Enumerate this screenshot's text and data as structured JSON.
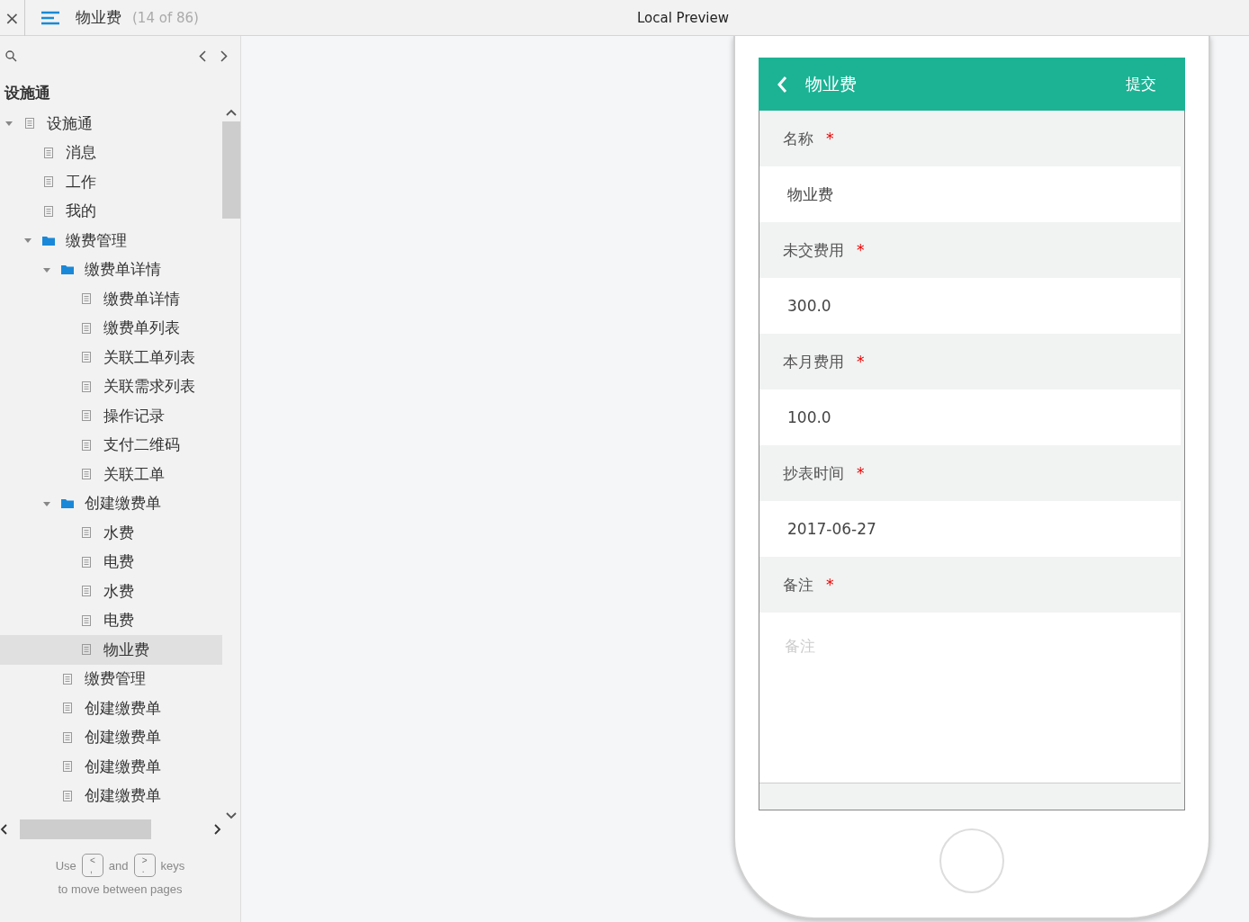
{
  "topbar": {
    "close": "×",
    "page_title": "物业费",
    "page_count": "(14 of 86)",
    "center_title": "Local Preview"
  },
  "sidebar": {
    "heading": "设施通",
    "tree": [
      {
        "label": "设施通",
        "kind": "page",
        "expanded": true,
        "selected": false,
        "children": [
          {
            "label": "消息",
            "kind": "page",
            "selected": false
          },
          {
            "label": "工作",
            "kind": "page",
            "selected": false
          },
          {
            "label": "我的",
            "kind": "page",
            "selected": false
          },
          {
            "label": "缴费管理",
            "kind": "folder",
            "expanded": true,
            "selected": false,
            "children": [
              {
                "label": "缴费单详情",
                "kind": "folder",
                "expanded": true,
                "selected": false,
                "children": [
                  {
                    "label": "缴费单详情",
                    "kind": "page",
                    "selected": false
                  },
                  {
                    "label": "缴费单列表",
                    "kind": "page",
                    "selected": false
                  },
                  {
                    "label": "关联工单列表",
                    "kind": "page",
                    "selected": false
                  },
                  {
                    "label": "关联需求列表",
                    "kind": "page",
                    "selected": false
                  },
                  {
                    "label": "操作记录",
                    "kind": "page",
                    "selected": false
                  },
                  {
                    "label": "支付二维码",
                    "kind": "page",
                    "selected": false
                  },
                  {
                    "label": "关联工单",
                    "kind": "page",
                    "selected": false
                  }
                ]
              },
              {
                "label": "创建缴费单",
                "kind": "folder",
                "expanded": true,
                "selected": false,
                "children": [
                  {
                    "label": "水费",
                    "kind": "page",
                    "selected": false
                  },
                  {
                    "label": "电费",
                    "kind": "page",
                    "selected": false
                  },
                  {
                    "label": "水费",
                    "kind": "page",
                    "selected": false
                  },
                  {
                    "label": "电费",
                    "kind": "page",
                    "selected": false
                  },
                  {
                    "label": "物业费",
                    "kind": "page",
                    "selected": true
                  }
                ]
              },
              {
                "label": "缴费管理",
                "kind": "page",
                "selected": false
              },
              {
                "label": "创建缴费单",
                "kind": "page",
                "selected": false
              },
              {
                "label": "创建缴费单",
                "kind": "page",
                "selected": false
              },
              {
                "label": "创建缴费单",
                "kind": "page",
                "selected": false
              },
              {
                "label": "创建缴费单",
                "kind": "page",
                "selected": false
              }
            ]
          }
        ]
      }
    ],
    "hint": {
      "use": "Use",
      "key_prev": "<\n,",
      "and": "and",
      "key_next": ">\n.",
      "keys": "keys",
      "line2": "to move between pages"
    }
  },
  "phone": {
    "header": {
      "title": "物业费",
      "action": "提交"
    },
    "fields": [
      {
        "label": "名称",
        "required": "*",
        "kind": "text",
        "value": "物业费"
      },
      {
        "label": "未交费用",
        "required": "*",
        "kind": "text",
        "value": "300.0"
      },
      {
        "label": "本月费用",
        "required": "*",
        "kind": "text",
        "value": "100.0"
      },
      {
        "label": "抄表时间",
        "required": "*",
        "kind": "text",
        "value": "2017-06-27"
      },
      {
        "label": "备注",
        "required": "*",
        "kind": "textarea",
        "placeholder": "备注"
      }
    ]
  }
}
